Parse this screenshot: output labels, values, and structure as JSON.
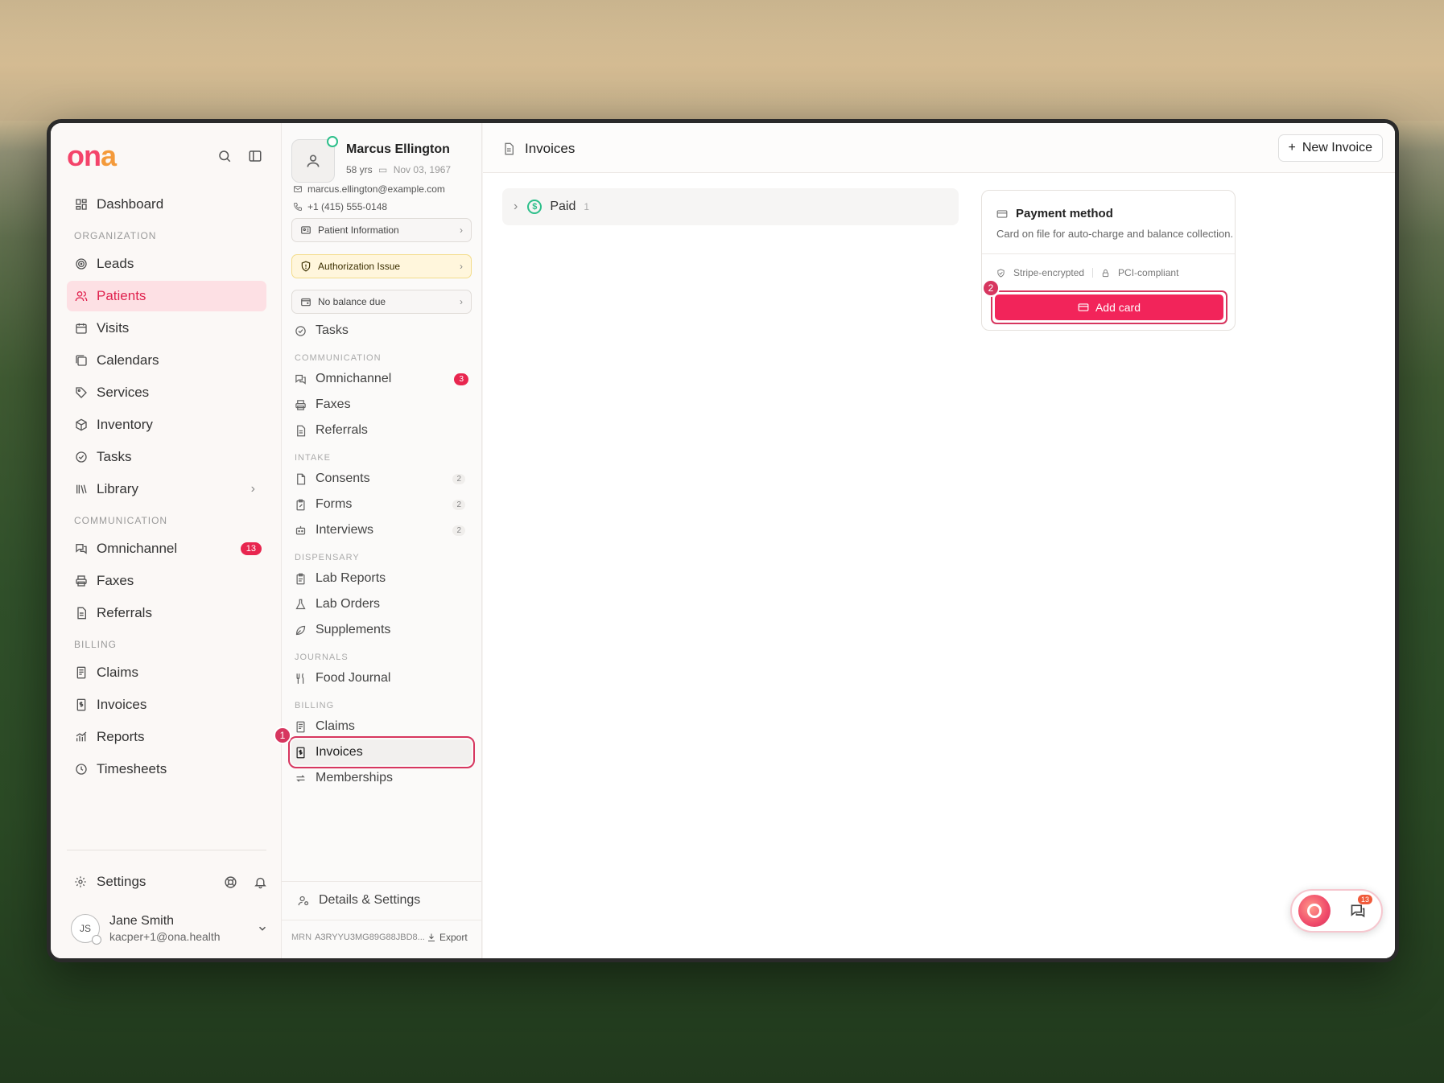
{
  "app": {
    "logo_text_1": "on",
    "logo_text_2": "a"
  },
  "leftnav": {
    "dashboard": "Dashboard",
    "sections": {
      "organization": "ORGANIZATION",
      "communication": "COMMUNICATION",
      "billing": "BILLING"
    },
    "org_items": [
      {
        "label": "Leads"
      },
      {
        "label": "Patients"
      },
      {
        "label": "Visits"
      },
      {
        "label": "Calendars"
      },
      {
        "label": "Services"
      },
      {
        "label": "Inventory"
      },
      {
        "label": "Tasks"
      },
      {
        "label": "Library"
      }
    ],
    "comm_items": [
      {
        "label": "Omnichannel",
        "badge": "13"
      },
      {
        "label": "Faxes"
      },
      {
        "label": "Referrals"
      }
    ],
    "billing_items": [
      {
        "label": "Claims"
      },
      {
        "label": "Invoices"
      },
      {
        "label": "Reports"
      },
      {
        "label": "Timesheets"
      }
    ],
    "settings": "Settings",
    "user": {
      "initials": "JS",
      "name": "Jane Smith",
      "email": "kacper+1@ona.health"
    }
  },
  "patient": {
    "name": "Marcus Ellington",
    "age": "58 yrs",
    "dob": "Nov 03, 1967",
    "email": "marcus.ellington@example.com",
    "phone": "+1 (415) 555-0148",
    "cards": {
      "info": "Patient Information",
      "auth": "Authorization Issue",
      "balance": "No balance due"
    },
    "nav": {
      "tasks": "Tasks",
      "sec_communication": "COMMUNICATION",
      "omnichannel": "Omnichannel",
      "omnichannel_badge": "3",
      "faxes": "Faxes",
      "referrals": "Referrals",
      "sec_intake": "INTAKE",
      "consents": "Consents",
      "consents_count": "2",
      "forms": "Forms",
      "forms_count": "2",
      "interviews": "Interviews",
      "interviews_count": "2",
      "sec_dispensary": "DISPENSARY",
      "lab_reports": "Lab Reports",
      "lab_orders": "Lab Orders",
      "supplements": "Supplements",
      "sec_journals": "JOURNALS",
      "food_journal": "Food Journal",
      "sec_billing": "BILLING",
      "claims": "Claims",
      "invoices": "Invoices",
      "memberships": "Memberships",
      "details": "Details & Settings"
    },
    "mrn_label": "MRN",
    "mrn_value": "A3RYYU3MG89G88JBD8...",
    "export": "Export"
  },
  "main": {
    "title": "Invoices",
    "new_invoice": "New Invoice",
    "group": {
      "label": "Paid",
      "count": "1"
    },
    "payment": {
      "title": "Payment method",
      "desc": "Card on file for auto-charge and balance collection.",
      "tag1": "Stripe-encrypted",
      "tag2": "PCI-compliant",
      "button": "Add card"
    },
    "chat_badge": "13"
  },
  "steps": {
    "one": "1",
    "two": "2"
  },
  "colors": {
    "accent": "#e8264f",
    "brand_pink": "#f4446a",
    "brand_orange": "#f49a3a",
    "success": "#2dbf8a"
  }
}
